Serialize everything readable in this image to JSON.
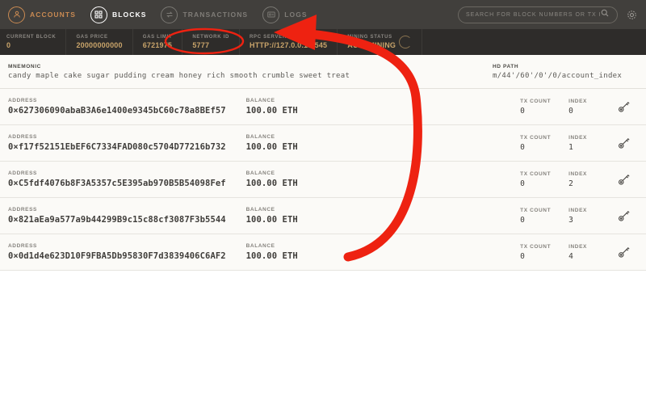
{
  "nav": {
    "items": [
      {
        "label": "ACCOUNTS",
        "icon": "user-icon",
        "state": "active"
      },
      {
        "label": "BLOCKS",
        "icon": "grid-icon",
        "state": "hover"
      },
      {
        "label": "TRANSACTIONS",
        "icon": "exchange-icon",
        "state": "dim"
      },
      {
        "label": "LOGS",
        "icon": "logs-icon",
        "state": "dim"
      }
    ],
    "search_placeholder": "SEARCH FOR BLOCK NUMBERS OR TX HASHES",
    "search_value": "",
    "settings_icon": "gear-icon"
  },
  "status": {
    "items": [
      {
        "label": "CURRENT BLOCK",
        "value": "0"
      },
      {
        "label": "GAS PRICE",
        "value": "20000000000"
      },
      {
        "label": "GAS LIMIT",
        "value": "6721975"
      },
      {
        "label": "NETWORK ID",
        "value": "5777"
      },
      {
        "label": "RPC SERVER",
        "value": "HTTP://127.0.0.1:7545"
      },
      {
        "label": "MINING STATUS",
        "value": "AUTOMINING"
      }
    ]
  },
  "mnemonic": {
    "label": "MNEMONIC",
    "value": "candy maple cake sugar pudding cream honey rich smooth crumble sweet treat",
    "hd_path_label": "HD PATH",
    "hd_path_value": "m/44'/60'/0'/0/account_index"
  },
  "table": {
    "labels": {
      "address": "ADDRESS",
      "balance": "BALANCE",
      "tx_count": "TX COUNT",
      "index": "INDEX"
    },
    "key_icon": "key-icon",
    "accounts": [
      {
        "address": "0×627306090abaB3A6e1400e9345bC60c78a8BEf57",
        "balance": "100.00 ETH",
        "tx_count": "0",
        "index": "0"
      },
      {
        "address": "0×f17f52151EbEF6C7334FAD080c5704D77216b732",
        "balance": "100.00 ETH",
        "tx_count": "0",
        "index": "1"
      },
      {
        "address": "0×C5fdf4076b8F3A5357c5E395ab970B5B54098Fef",
        "balance": "100.00 ETH",
        "tx_count": "0",
        "index": "2"
      },
      {
        "address": "0×821aEa9a577a9b44299B9c15c88cf3087F3b5544",
        "balance": "100.00 ETH",
        "tx_count": "0",
        "index": "3"
      },
      {
        "address": "0×0d1d4e623D10F9FBA5Db95830F7d3839406C6AF2",
        "balance": "100.00 ETH",
        "tx_count": "0",
        "index": "4"
      }
    ]
  },
  "annotation": {
    "color": "#ee2211",
    "shapes": [
      "ellipse-highlight-rpc-server",
      "curved-arrow-pointing-to-status-bar"
    ]
  },
  "colors": {
    "navbar_bg": "#413f3c",
    "statusbar_bg": "#2e2c2a",
    "accent": "#c98a52",
    "value_gold": "#c9a46a",
    "content_bg": "#fbfaf7",
    "annotation_red": "#ee2211"
  }
}
